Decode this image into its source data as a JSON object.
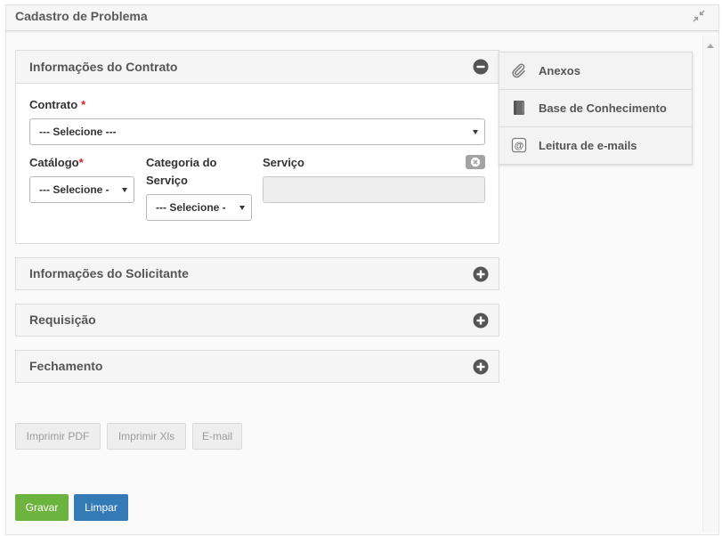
{
  "window": {
    "title": "Cadastro de Problema",
    "resize_icon": "compress-icon"
  },
  "sections": [
    {
      "title": "Informações do Contrato",
      "toggle_icon": "minus-circle-icon",
      "expanded": true
    },
    {
      "title": "Informações do Solicitante",
      "toggle_icon": "plus-circle-icon",
      "expanded": false
    },
    {
      "title": "Requisição",
      "toggle_icon": "plus-circle-icon",
      "expanded": false
    },
    {
      "title": "Fechamento",
      "toggle_icon": "plus-circle-icon",
      "expanded": false
    }
  ],
  "form": {
    "contrato": {
      "label": "Contrato",
      "required_mark": "*",
      "selected": "--- Selecione ---"
    },
    "catalogo": {
      "label": "Catálogo",
      "required_mark": "*",
      "selected": "--- Selecione -"
    },
    "categoria_servico": {
      "label": "Categoria do Serviço",
      "selected": "--- Selecione -"
    },
    "servico": {
      "label": "Serviço",
      "value": "",
      "disabled": true,
      "clear_icon": "clear-circle-icon"
    }
  },
  "side_menu": [
    {
      "label": "Anexos",
      "icon": "paperclip-icon"
    },
    {
      "label": "Base de Conhecimento",
      "icon": "book-icon"
    },
    {
      "label": "Leitura de e-mails",
      "icon": "at-sign-icon",
      "glyph": "@"
    }
  ],
  "export_buttons": [
    {
      "label": "Imprimir PDF",
      "disabled": true
    },
    {
      "label": "Imprimir Xls",
      "disabled": true
    },
    {
      "label": "E-mail",
      "disabled": true
    }
  ],
  "actions": {
    "save": {
      "label": "Gravar",
      "color": "#6cb33f"
    },
    "clear": {
      "label": "Limpar",
      "color": "#337ab7"
    }
  },
  "colors": {
    "required_mark": "#d2232a",
    "panel_header": "#f5f5f5",
    "toggle_icon": "#555555"
  },
  "scrollbar": {
    "up_icon": "scroll-up-arrow-icon"
  }
}
